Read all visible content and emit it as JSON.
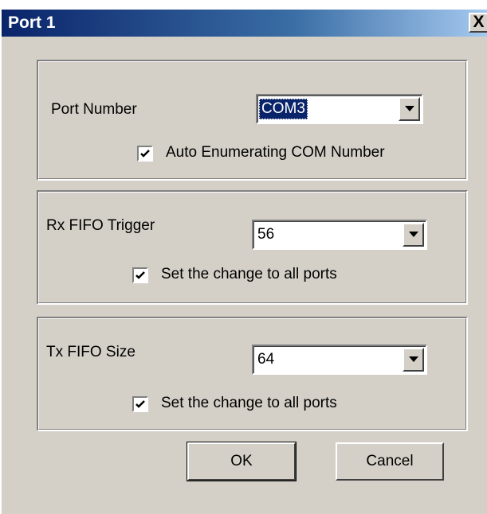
{
  "window": {
    "title": "Port 1",
    "close_glyph": "X"
  },
  "port_group": {
    "label": "Port Number",
    "value": "COM3",
    "checkbox_label": "Auto Enumerating COM Number",
    "checkbox_checked": true
  },
  "rx_group": {
    "label": "Rx FIFO Trigger",
    "value": "56",
    "checkbox_label": "Set the change to all ports",
    "checkbox_checked": true
  },
  "tx_group": {
    "label": "Tx FIFO Size",
    "value": "64",
    "checkbox_label": "Set the change to all ports",
    "checkbox_checked": true
  },
  "buttons": {
    "ok": "OK",
    "cancel": "Cancel"
  },
  "colors": {
    "title_active": "#0a246a",
    "face": "#d4d0c8",
    "selection": "#0a246a"
  }
}
